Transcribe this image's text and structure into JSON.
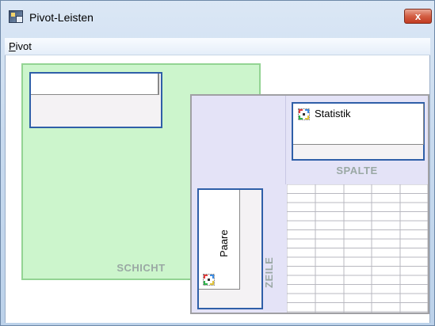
{
  "window": {
    "title": "Pivot-Leisten",
    "close_symbol": "x"
  },
  "menu": {
    "items": [
      {
        "label": "Pivot",
        "mnemonic": "P"
      }
    ]
  },
  "pivot": {
    "layer_tray": {
      "label": "SCHICHT",
      "items": []
    },
    "column_tray": {
      "label": "SPALTE",
      "items": [
        {
          "label": "Statistik",
          "icon": "pivot-dimension-icon"
        }
      ]
    },
    "row_tray": {
      "label": "ZEILE",
      "items": [
        {
          "label": "Paare",
          "icon": "pivot-dimension-icon"
        }
      ]
    }
  },
  "colors": {
    "layer_bg": "#ccf5cc",
    "pivot_bg": "#e4e3f7",
    "item_border": "#2f5fa8",
    "tray_label": "#9aa8a4"
  }
}
